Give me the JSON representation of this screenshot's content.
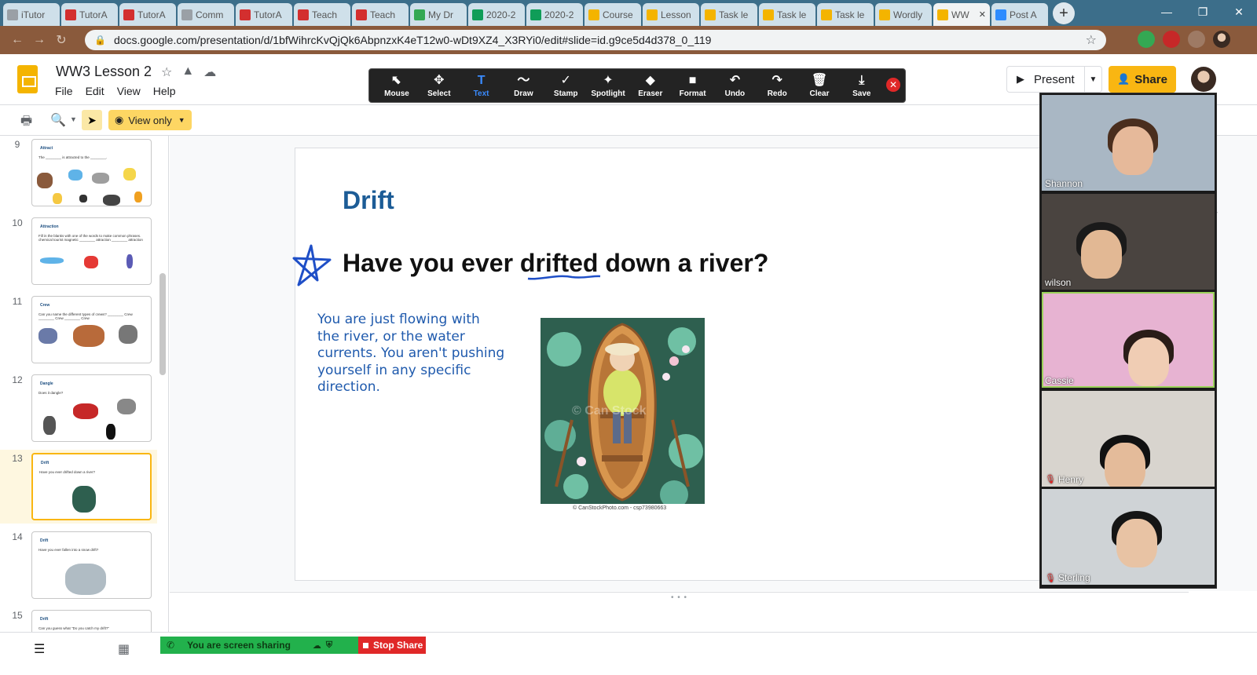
{
  "browser": {
    "tabs": [
      {
        "title": "iTutor",
        "fav": "chrome-icon",
        "color": "#9aa0a6"
      },
      {
        "title": "TutorA",
        "fav": "i-icon",
        "color": "#d32f2f"
      },
      {
        "title": "TutorA",
        "fav": "i-icon",
        "color": "#d32f2f"
      },
      {
        "title": "Comm",
        "fav": "chrome-icon",
        "color": "#9aa0a6"
      },
      {
        "title": "TutorA",
        "fav": "i-icon",
        "color": "#d32f2f"
      },
      {
        "title": "Teach",
        "fav": "i-icon",
        "color": "#d32f2f"
      },
      {
        "title": "Teach",
        "fav": "i-icon",
        "color": "#d32f2f"
      },
      {
        "title": "My Dr",
        "fav": "drive-icon",
        "color": "#34a853"
      },
      {
        "title": "2020-2",
        "fav": "sheets-icon",
        "color": "#0f9d58"
      },
      {
        "title": "2020-2",
        "fav": "sheets-icon",
        "color": "#0f9d58"
      },
      {
        "title": "Course",
        "fav": "classroom-icon",
        "color": "#f4b400"
      },
      {
        "title": "Lesson",
        "fav": "classroom-icon",
        "color": "#f4b400"
      },
      {
        "title": "Task le",
        "fav": "classroom-icon",
        "color": "#f4b400"
      },
      {
        "title": "Task le",
        "fav": "classroom-icon",
        "color": "#f4b400"
      },
      {
        "title": "Task le",
        "fav": "classroom-icon",
        "color": "#f4b400"
      },
      {
        "title": "Wordly",
        "fav": "classroom-icon",
        "color": "#f4b400"
      },
      {
        "title": "WW",
        "fav": "slides-icon",
        "color": "#f4b400",
        "active": true
      },
      {
        "title": "Post A",
        "fav": "zoom-icon",
        "color": "#2d8cff"
      }
    ],
    "url": "docs.google.com/presentation/d/1bfWihrcKvQjQk6AbpnzxK4eT12w0-wDt9XZ4_X3RYi0/edit#slide=id.g9ce5d4d378_0_119"
  },
  "doc": {
    "title": "WW3 Lesson 2",
    "menu": [
      "File",
      "Edit",
      "View",
      "Help"
    ],
    "view_only": "View only",
    "present": "Present",
    "share": "Share"
  },
  "annotation_toolbar": {
    "tools": [
      {
        "label": "Mouse",
        "glyph": "⬉"
      },
      {
        "label": "Select",
        "glyph": "✥"
      },
      {
        "label": "Text",
        "glyph": "T",
        "selected": true
      },
      {
        "label": "Draw",
        "glyph": "〜"
      },
      {
        "label": "Stamp",
        "glyph": "✓"
      },
      {
        "label": "Spotlight",
        "glyph": "✦"
      },
      {
        "label": "Eraser",
        "glyph": "◆"
      },
      {
        "label": "Format",
        "glyph": "■"
      },
      {
        "label": "Undo",
        "glyph": "↶"
      },
      {
        "label": "Redo",
        "glyph": "↷"
      },
      {
        "label": "Clear",
        "glyph": "🗑"
      },
      {
        "label": "Save",
        "glyph": "⤓"
      }
    ]
  },
  "filmstrip": [
    {
      "num": "9",
      "title": "Attract",
      "body": "The ________ is attracted to the ________."
    },
    {
      "num": "10",
      "title": "Attraction",
      "body": "Fill in the blanks with one of the words to make common phrases. chemical  tourist  magnetic  ________ attraction  ________ attraction"
    },
    {
      "num": "11",
      "title": "Crew",
      "body": "Can you name the different types of crews?  ________ Crew  ________ Crew  ________ Crew"
    },
    {
      "num": "12",
      "title": "Dangle",
      "body": "Does it dangle?"
    },
    {
      "num": "13",
      "title": "Drift",
      "body": "Have you ever drifted down a river?",
      "active": true
    },
    {
      "num": "14",
      "title": "Drift",
      "body": "Have you ever fallen into a snow drift?"
    },
    {
      "num": "15",
      "title": "Drift",
      "body": "Can you guess what \"Do you catch my drift?\""
    }
  ],
  "slide": {
    "title": "Drift",
    "question": "Have you ever drifted down a river?",
    "description": "You are just flowing with the river, or the water currents.  You aren't pushing yourself in any specific direction.",
    "credit": "© CanStockPhoto.com - csp73980663",
    "watermark": "© Can Stock"
  },
  "screen_share": {
    "status": "You are screen sharing",
    "stop": "Stop Share"
  },
  "participants": [
    {
      "name": "Shannon",
      "muted": false,
      "bg": "#a9b7c4",
      "skin": "#e6b99a",
      "hair": "#4a2e1e"
    },
    {
      "name": "wilson",
      "muted": false,
      "bg": "#4a4440",
      "skin": "#e2b894",
      "hair": "#1a1a1a"
    },
    {
      "name": "Cassie",
      "muted": false,
      "bg": "#e7b3d2",
      "skin": "#f0cdb4",
      "hair": "#2a1d18",
      "active": true
    },
    {
      "name": "Henry",
      "muted": true,
      "bg": "#d8d4ce",
      "skin": "#e4bb9a",
      "hair": "#111111"
    },
    {
      "name": "Sterling",
      "muted": true,
      "bg": "#cfd3d6",
      "skin": "#e8c3a4",
      "hair": "#151515"
    }
  ]
}
